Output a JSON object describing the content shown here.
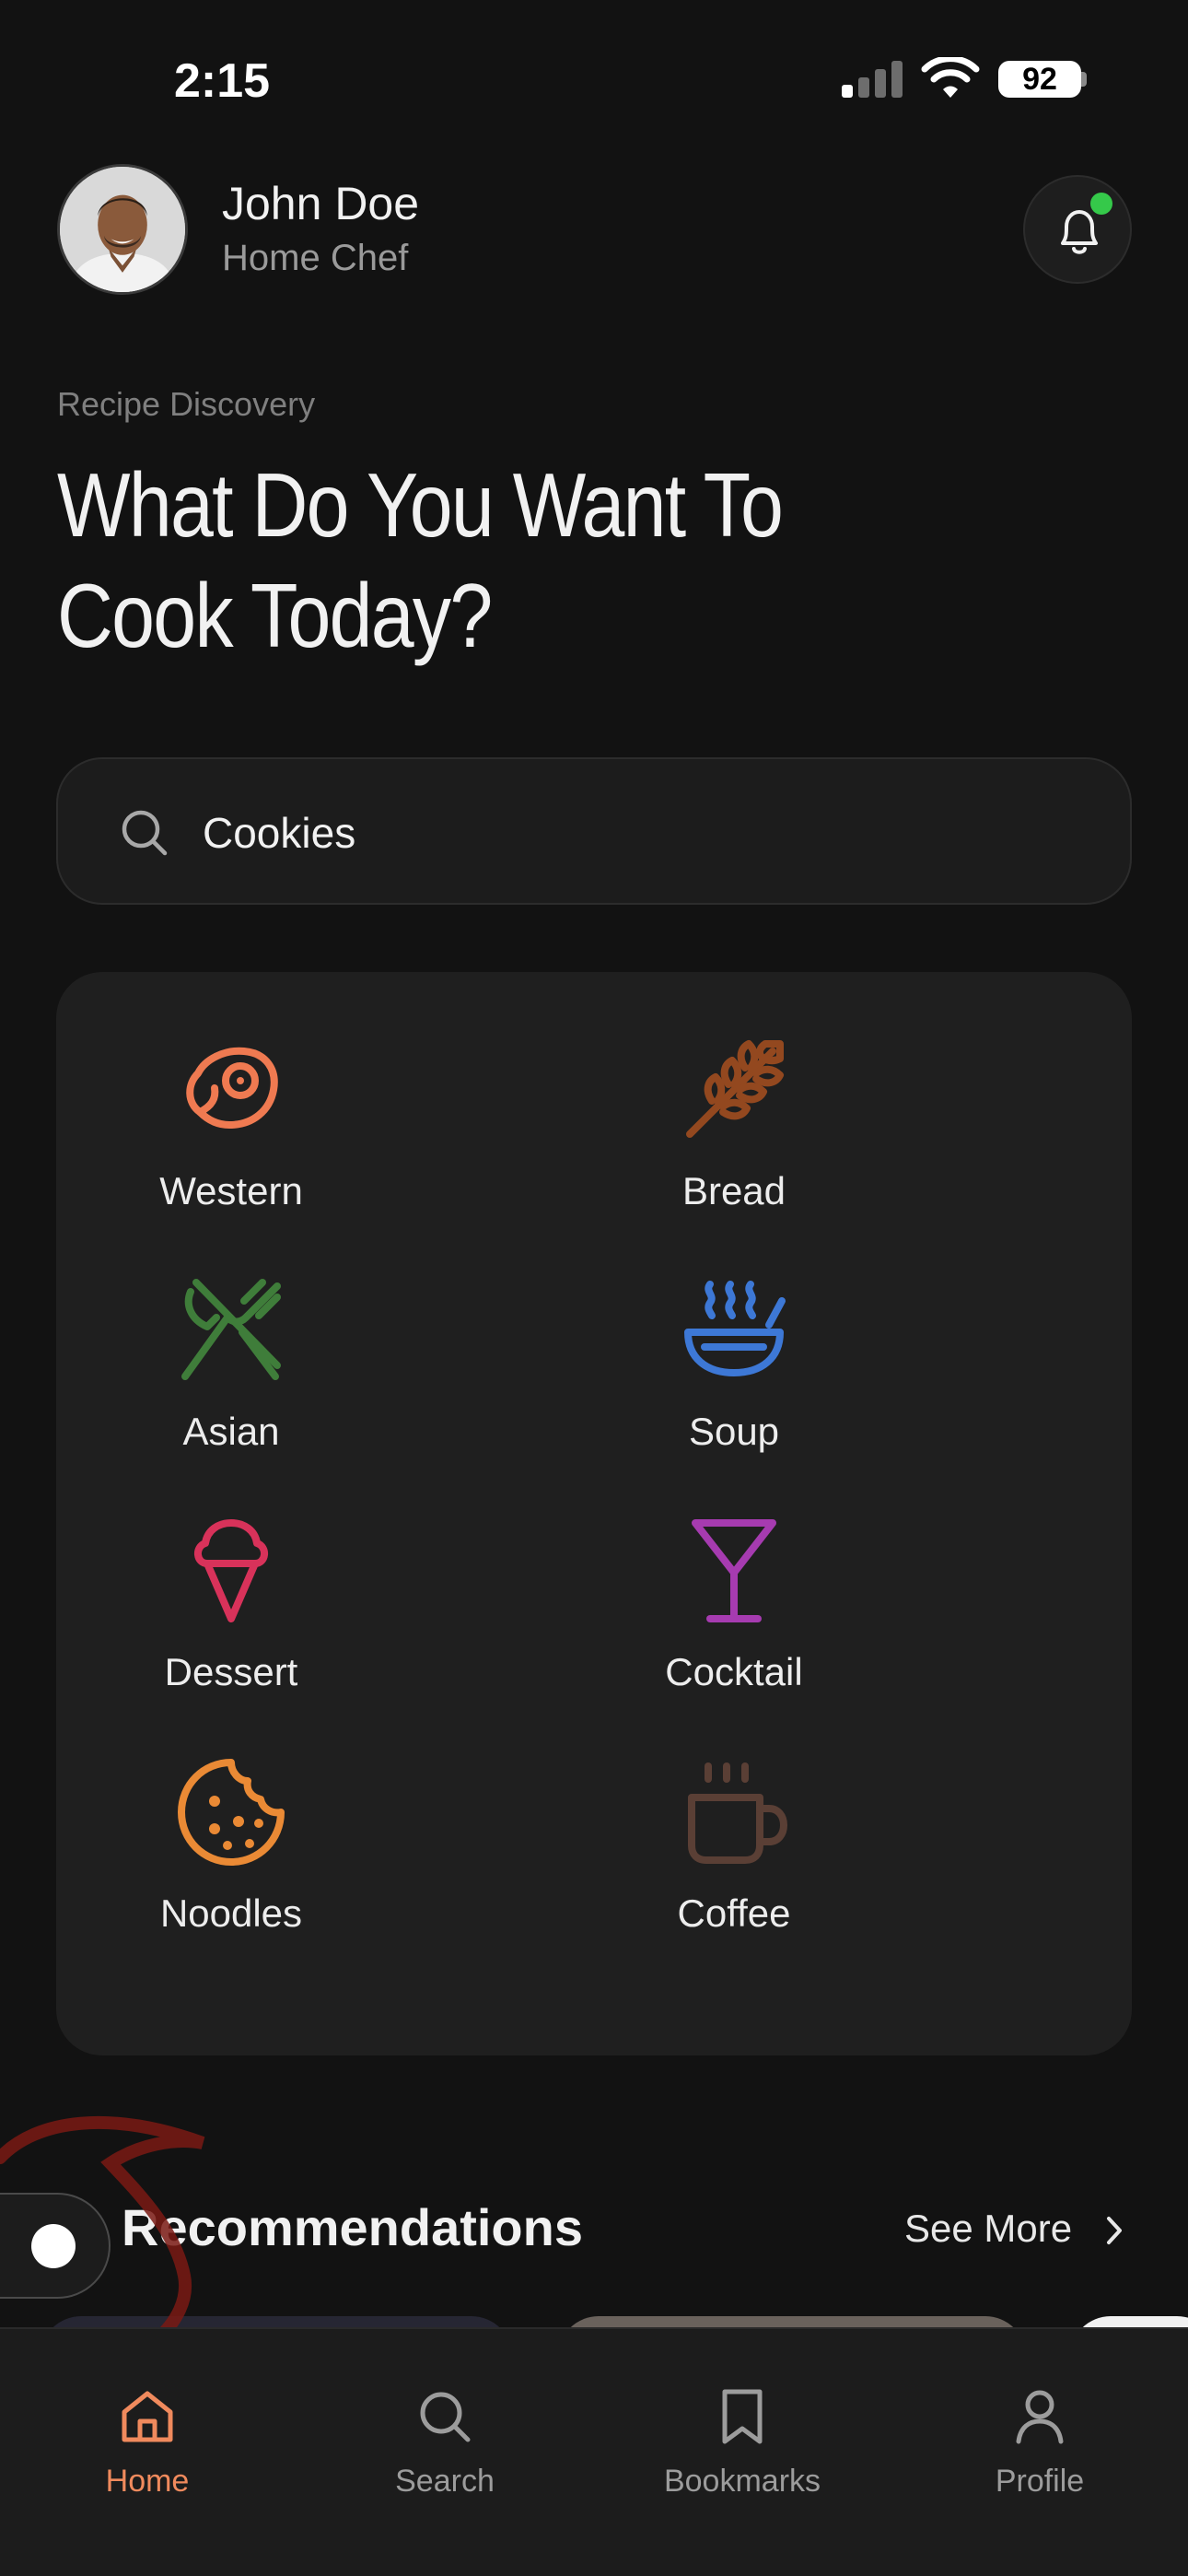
{
  "status_bar": {
    "time": "2:15",
    "battery": "92"
  },
  "header": {
    "user_name": "John Doe",
    "user_role": "Home Chef",
    "notification_dot_color": "#35c94a"
  },
  "hero": {
    "kicker": "Recipe Discovery",
    "headline_line1": "What Do You Want To",
    "headline_line2": "Cook Today?"
  },
  "search": {
    "value": "Cookies",
    "icon": "search-icon"
  },
  "categories": [
    {
      "label": "Western",
      "icon": "steak-icon",
      "color": "#ef7a51"
    },
    {
      "label": "Bread",
      "icon": "wheat-icon",
      "color": "#93481f"
    },
    {
      "label": "Asian",
      "icon": "utensils-crossed-icon",
      "color": "#3f7d3a"
    },
    {
      "label": "Soup",
      "icon": "soup-bowl-icon",
      "color": "#3d78d6"
    },
    {
      "label": "Dessert",
      "icon": "ice-cream-icon",
      "color": "#d8325a"
    },
    {
      "label": "Cocktail",
      "icon": "martini-icon",
      "color": "#a63bb0"
    },
    {
      "label": "Noodles",
      "icon": "cookie-icon",
      "color": "#ea8a35"
    },
    {
      "label": "Coffee",
      "icon": "coffee-icon",
      "color": "#5a3f35"
    }
  ],
  "recommendations": {
    "title": "Recommendations",
    "see_more": "See More"
  },
  "tabbar": {
    "items": [
      {
        "label": "Home",
        "icon": "home-icon",
        "active": true
      },
      {
        "label": "Search",
        "icon": "search-icon",
        "active": false
      },
      {
        "label": "Bookmarks",
        "icon": "bookmark-icon",
        "active": false
      },
      {
        "label": "Profile",
        "icon": "user-icon",
        "active": false
      }
    ],
    "accent": "#f08a5d"
  }
}
